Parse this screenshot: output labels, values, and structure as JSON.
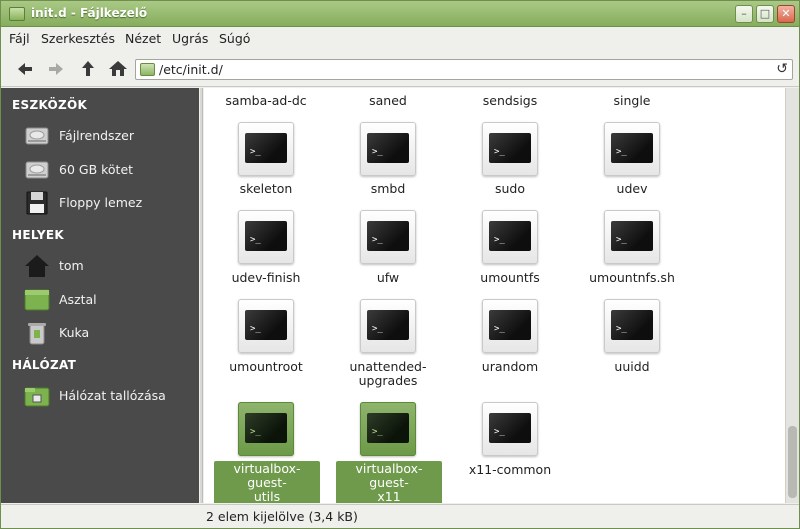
{
  "window": {
    "title": "init.d - Fájlkezelő"
  },
  "menu": [
    "Fájl",
    "Szerkesztés",
    "Nézet",
    "Ugrás",
    "Súgó"
  ],
  "toolbar": {
    "back_icon": "arrow-left-icon",
    "forward_icon": "arrow-right-icon",
    "up_icon": "arrow-up-icon",
    "home_icon": "home-icon",
    "location": "/etc/init.d/",
    "reload_icon": "reload-icon"
  },
  "sidebar": {
    "sections": [
      {
        "heading": "ESZKÖZÖK",
        "items": [
          {
            "label": "Fájlrendszer",
            "icon": "drive-icon"
          },
          {
            "label": "60 GB kötet",
            "icon": "drive-icon"
          },
          {
            "label": "Floppy lemez",
            "icon": "floppy-icon"
          }
        ]
      },
      {
        "heading": "HELYEK",
        "items": [
          {
            "label": "tom",
            "icon": "home-folder-icon"
          },
          {
            "label": "Asztal",
            "icon": "desktop-icon"
          },
          {
            "label": "Kuka",
            "icon": "trash-icon"
          }
        ]
      },
      {
        "heading": "HÁLÓZAT",
        "items": [
          {
            "label": "Hálózat tallózása",
            "icon": "network-icon"
          }
        ]
      }
    ]
  },
  "files": {
    "top_row": [
      "samba-ad-dc",
      "saned",
      "sendsigs",
      "single"
    ],
    "rows": [
      [
        "skeleton",
        "smbd",
        "sudo",
        "udev"
      ],
      [
        "udev-finish",
        "ufw",
        "umountfs",
        "umountnfs.sh"
      ],
      [
        "umountroot",
        "unattended-\nupgrades",
        "urandom",
        "uuidd"
      ],
      [
        "virtualbox-guest-\nutils",
        "virtualbox-guest-\nx11",
        "x11-common"
      ]
    ],
    "selected": [
      "virtualbox-guest-\nutils",
      "virtualbox-guest-\nx11"
    ]
  },
  "status": "2 elem kijelölve (3,4 kB)",
  "colors": {
    "accent": "#6f9a4c",
    "sidebar_bg": "#4a4a4a",
    "titlebar": "#97bb6e"
  }
}
